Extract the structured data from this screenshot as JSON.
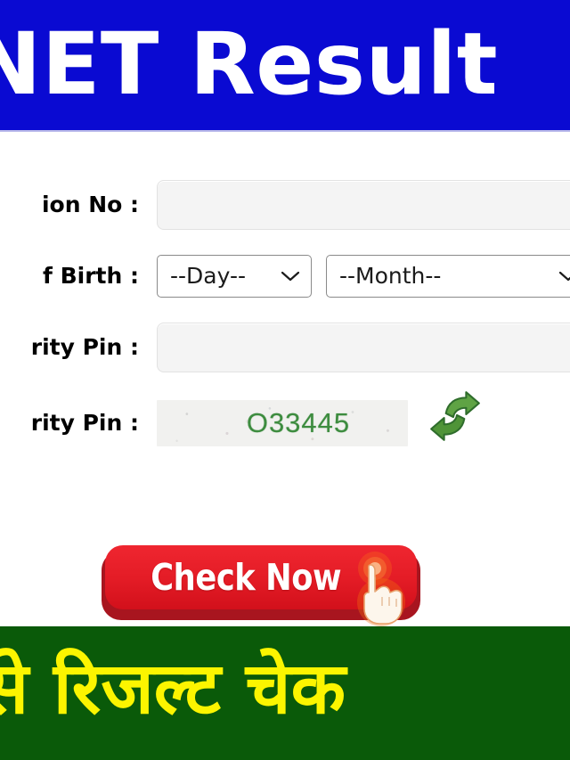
{
  "header": {
    "title": "NET Result",
    "background_color": "#0a0ad2",
    "text_color": "#ffffff"
  },
  "form": {
    "fields": [
      {
        "label": "ion No :",
        "type": "text",
        "value": "",
        "placeholder": ""
      },
      {
        "label": "f Birth :",
        "type": "date-selects",
        "day_value": "--Day--",
        "month_value": "--Month--"
      },
      {
        "label": "rity Pin :",
        "type": "text",
        "value": "",
        "placeholder": ""
      },
      {
        "label": "rity Pin :",
        "type": "captcha",
        "captcha_text": "O33445",
        "captcha_text_color": "#3d8c3f",
        "refresh_icon": "refresh-icon"
      }
    ]
  },
  "cta": {
    "label": "Check Now",
    "background_color": "#e41c26",
    "shadow_color": "#a8151f",
    "text_color": "#ffffff",
    "cursor_icon": "hand-pointer-icon"
  },
  "footer": {
    "text": "से रिजल्ट चेक",
    "background_color": "#0a5a09",
    "text_color": "#fcf500"
  }
}
